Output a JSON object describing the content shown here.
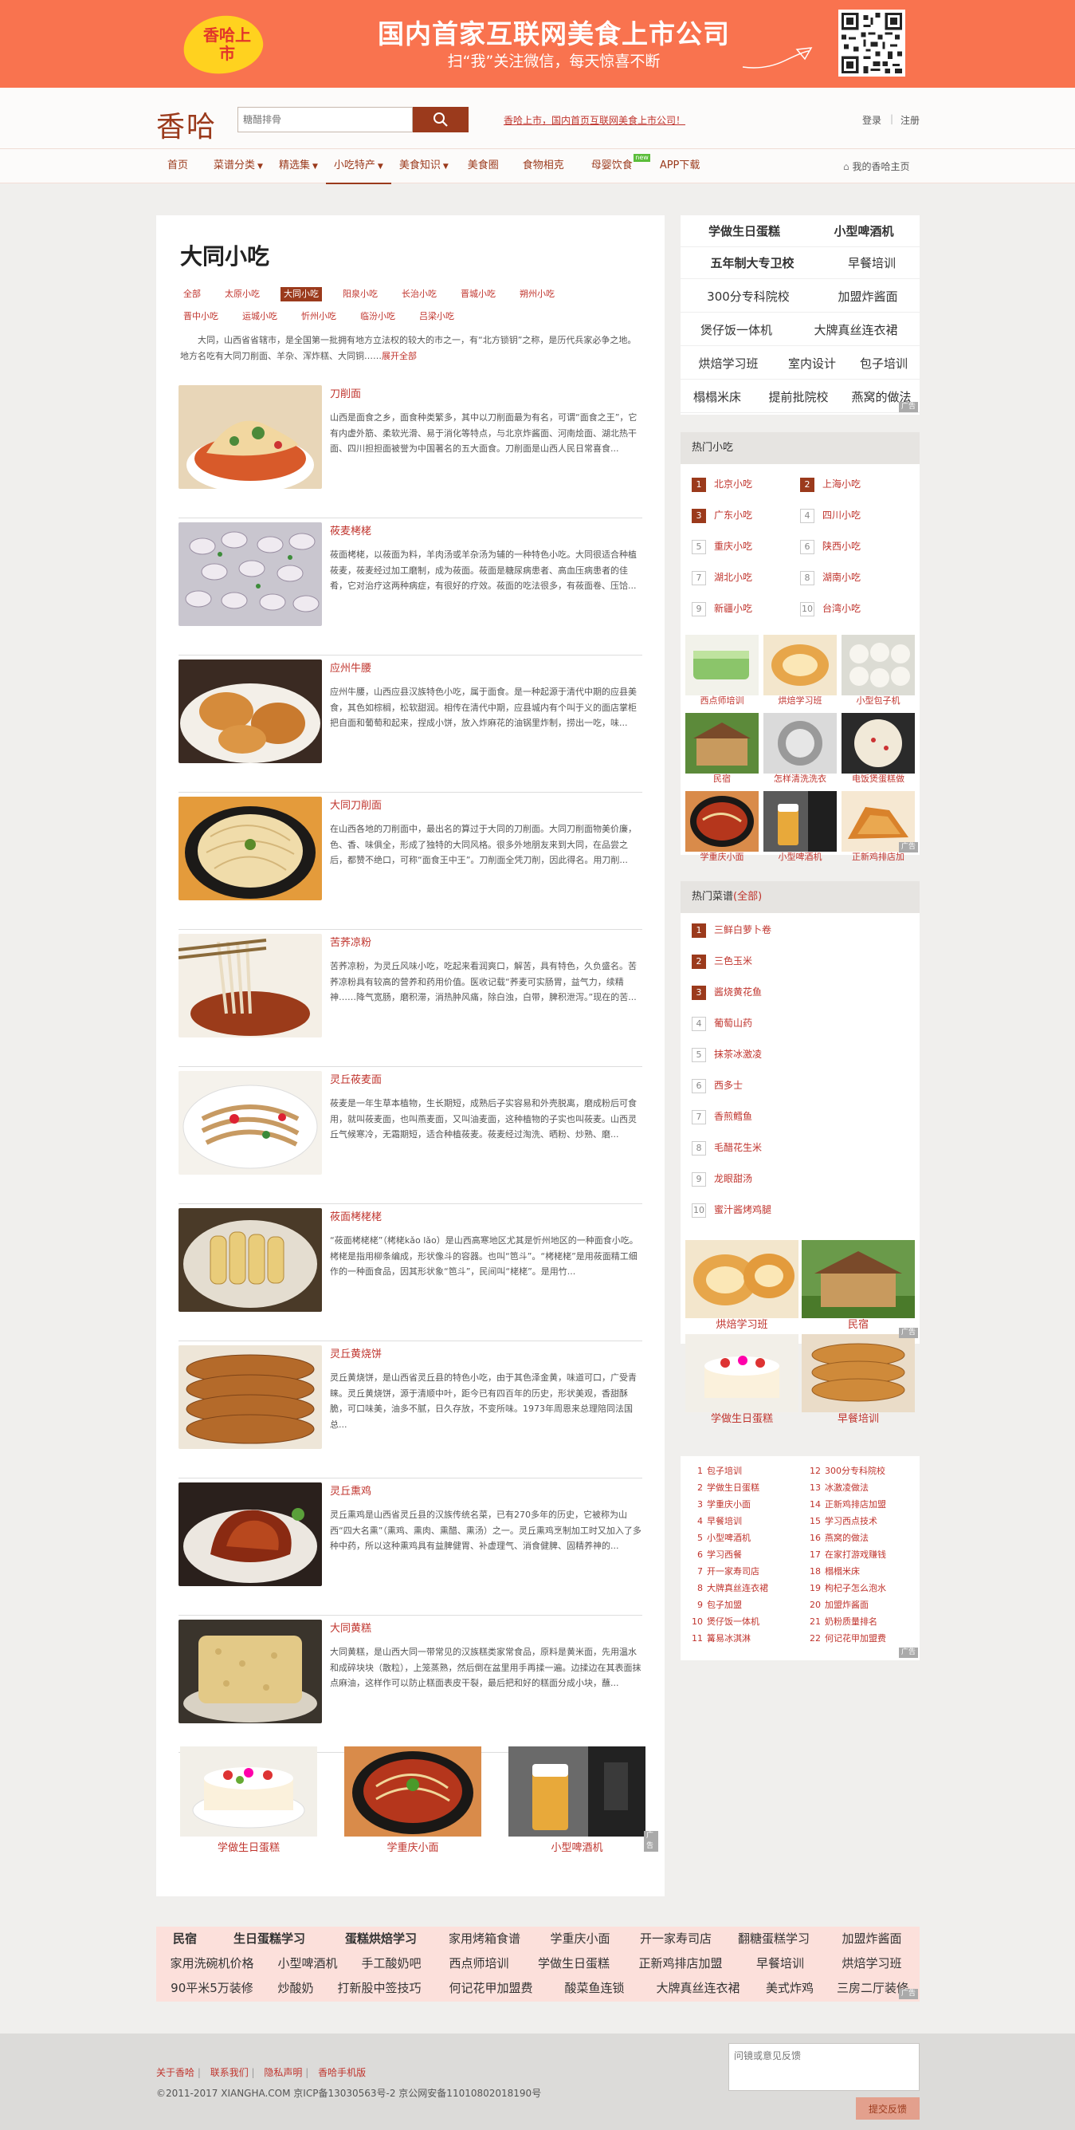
{
  "banner": {
    "badge": "香哈上市",
    "headline": "国内首家互联网美食上市公司",
    "subline": "扫“我”关注微信，每天惊喜不断"
  },
  "header": {
    "logo": "香哈",
    "search_placeholder": "糖醋排骨",
    "promo": "香哈上市，国内首页互联网美食上市公司！",
    "login": "登录",
    "register": "注册"
  },
  "nav": {
    "items": [
      {
        "label": "首页"
      },
      {
        "label": "菜谱分类"
      },
      {
        "label": "精选集"
      },
      {
        "label": "小吃特产"
      },
      {
        "label": "美食知识"
      },
      {
        "label": "美食圈"
      },
      {
        "label": "食物相克"
      },
      {
        "label": "母婴饮食"
      },
      {
        "label": "APP下载"
      }
    ],
    "new_badge": "new",
    "home": "我的香哈主页"
  },
  "main": {
    "title": "大同小吃",
    "categories": [
      "全部",
      "太原小吃",
      "大同小吃",
      "阳泉小吃",
      "长治小吃",
      "晋城小吃",
      "朔州小吃",
      "晋中小吃",
      "运城小吃",
      "忻州小吃",
      "临汾小吃",
      "吕梁小吃"
    ],
    "intro": "大同，山西省省辖市，是全国第一批拥有地方立法权的较大的市之一，有“北方锁钥”之称，是历代兵家必争之地。 地方名吃有大同刀削面、羊杂、浑炸糕、大同铜……",
    "intro_more": "展开全部",
    "items": [
      {
        "name": "刀削面",
        "desc": "山西是面食之乡，面食种类繁多，其中以刀削面最为有名，可谓“面食之王”，它有内虚外筋、柔软光滑、易于消化等特点，与北京炸酱面、河南烩面、湖北热干面、四川担担面被誉为中国著名的五大面食。刀削面是山西人民日常喜食..."
      },
      {
        "name": "莜麦栲栳",
        "desc": "莜面栲栳，以莜面为料，羊肉汤或羊杂汤为辅的一种特色小吃。大同很适合种植莜麦，莜麦经过加工磨制，成为莜面。莜面是糖尿病患者、高血压病患者的佳肴，它对治疗这两种病症，有很好的疗效。莜面的吃法很多，有莜面卷、压饸..."
      },
      {
        "name": "应州牛腰",
        "desc": "应州牛腰，山西应县汉族特色小吃，属于面食。是一种起源于清代中期的应县美食，其色如棕榈，松软甜润。相传在清代中期，应县城内有个叫于义的面店掌柜把自面和葡萄和起来，捏成小饼，放入炸麻花的油锅里炸制，捞出一吃，味..."
      },
      {
        "name": "大同刀削面",
        "desc": "在山西各地的刀削面中，最出名的算过于大同的刀削面。大同刀削面物美价廉，色、香、味俱全，形成了独特的大同风格。很多外地朋友来到大同，在品尝之后，都赞不绝口，可称“面食王中王”。刀削面全凭刀削，因此得名。用刀削..."
      },
      {
        "name": "苦荞凉粉",
        "desc": "苦荞凉粉，为灵丘风味小吃，吃起来看润爽口，解苦，具有特色，久负盛名。苦荞凉粉具有较高的营养和药用价值。医收记载“荞麦可实肠胃，益气力，续精神……降气宽肠，磨积滞，消热肿风痛，除白浊，白带，脾积泄泻。”现在的苦..."
      },
      {
        "name": "灵丘莜麦面",
        "desc": "莜麦是一年生草本植物，生长期短，成熟后子实容易和外壳脱离，磨成粉后可食用，就叫莜麦面，也叫燕麦面，又叫油麦面，这种植物的子实也叫莜麦。山西灵丘气候寒冷，无霜期短，适合种植莜麦。莜麦经过淘洗、晒粉、炒熟、磨..."
      },
      {
        "name": "莜面栲栳栳",
        "desc": "“莜面栲栳栳”（栲栳kǎo lǎo）是山西高寒地区尤其是忻州地区的一种面食小吃。栲栳是指用柳条编成，形状像斗的容器。也叫“笆斗”。“栲栳栳”是用莜面精工细作的一种面食品，因其形状象“笆斗”，民间叫“栳栳”。是用竹..."
      },
      {
        "name": "灵丘黄烧饼",
        "desc": "灵丘黄烧饼，是山西省灵丘县的特色小吃，由于其色泽金黄，味道可口，广受青睐。灵丘黄烧饼，源于清顺中叶，距今已有四百年的历史，形状美观，香甜酥脆，可口味美，油多不腻，日久存放，不变所味。1973年周恩来总理陪同法国总..."
      },
      {
        "name": "灵丘熏鸡",
        "desc": "灵丘熏鸡是山西省灵丘县的汉族传统名菜，已有270多年的历史，它被称为山西“四大名熏”（熏鸡、熏肉、熏醋、熏汤）之一。灵丘熏鸡烹制加工时又加入了多种中药，所以这种熏鸡具有益脾健胃、补虚理气、消食健脾、固精养神的..."
      },
      {
        "name": "大同黄糕",
        "desc": "大同黄糕，是山西大同一带常见的汉族糕类家常食品，原料是黄米面，先用温水和成碎块块（散粒），上笼蒸熟，然后倒在盆里用手再揉一遍。边揉边在其表面抹点麻油，这样作可以防止糕面表皮干裂，最后把和好的糕面分成小块，蘸..."
      }
    ],
    "bottom_ads": [
      "学做生日蛋糕",
      "学重庆小面",
      "小型啤酒机"
    ],
    "ad_tag": "广告"
  },
  "sidebar": {
    "tags": [
      {
        "label": "学做生日蛋糕",
        "bold": true
      },
      {
        "label": "小型啤酒机",
        "bold": true
      },
      {
        "label": "五年制大专卫校",
        "bold": true
      },
      {
        "label": "早餐培训",
        "bold": false
      },
      {
        "label": "300分专科院校",
        "bold": false
      },
      {
        "label": "加盟炸酱面",
        "bold": false
      },
      {
        "label": "煲仔饭一体机",
        "bold": false
      },
      {
        "label": "大牌真丝连衣裙",
        "bold": false
      },
      {
        "label": "烘焙学习班",
        "bold": false
      },
      {
        "label": "室内设计",
        "bold": false
      },
      {
        "label": "包子培训",
        "bold": false
      },
      {
        "label": "榻榻米床",
        "bold": false
      },
      {
        "label": "提前批院校",
        "bold": false
      },
      {
        "label": "燕窝的做法",
        "bold": false
      }
    ],
    "hot_snacks_title": "热门小吃",
    "hot_snacks": [
      "北京小吃",
      "上海小吃",
      "广东小吃",
      "四川小吃",
      "重庆小吃",
      "陕西小吃",
      "湖北小吃",
      "湖南小吃",
      "新疆小吃",
      "台湾小吃"
    ],
    "thumbs1": [
      "西点师培训",
      "烘焙学习班",
      "小型包子机",
      "民宿",
      "怎样清洗洗衣",
      "电饭煲蛋糕做",
      "学重庆小面",
      "小型啤酒机",
      "正新鸡排店加"
    ],
    "hot_recipes_title": "热门菜谱",
    "hot_recipes_all": "(全部)",
    "hot_recipes": [
      "三鲜白萝卜卷",
      "三色玉米",
      "酱烧黄花鱼",
      "葡萄山药",
      "抹茶冰激凌",
      "西多士",
      "香煎鳕鱼",
      "毛醋花生米",
      "龙眼甜汤",
      "蜜汁酱烤鸡腿"
    ],
    "thumbs2": [
      "烘焙学习班",
      "民宿",
      "学做生日蛋糕",
      "早餐培训"
    ],
    "links": [
      "包子培训",
      "300分专科院校",
      "学做生日蛋糕",
      "冰激凌做法",
      "学重庆小面",
      "正新鸡排店加盟",
      "早餐培训",
      "学习西点技术",
      "小型啤酒机",
      "燕窝的做法",
      "学习西餐",
      "在家打游戏赚钱",
      "开一家寿司店",
      "榻榻米床",
      "大牌真丝连衣裙",
      "枸杞子怎么泡水",
      "包子加盟",
      "加盟炸酱面",
      "煲仔饭一体机",
      "奶粉质量排名",
      "篝易冰淇淋",
      "何记花甲加盟费"
    ],
    "ad_tag": "广告"
  },
  "tagblock": {
    "rows": [
      [
        "民宿",
        "生日蛋糕学习",
        "蛋糕烘焙学习",
        "家用烤箱食谱",
        "学重庆小面",
        "开一家寿司店",
        "翻糖蛋糕学习",
        "加盟炸酱面"
      ],
      [
        "家用洗碗机价格",
        "小型啤酒机",
        "手工酸奶吧",
        "西点师培训",
        "学做生日蛋糕",
        "正新鸡排店加盟",
        "早餐培训",
        "烘焙学习班"
      ],
      [
        "90平米5万装修",
        "炒酸奶",
        "打新股中签技巧",
        "何记花甲加盟费",
        "酸菜鱼连锁",
        "大牌真丝连衣裙",
        "美式炸鸡",
        "三房二厅装修"
      ]
    ],
    "bold": [
      "民宿",
      "生日蛋糕学习",
      "蛋糕烘焙学习"
    ],
    "ad_tag": "广告"
  },
  "footer": {
    "links": [
      "关于香哈",
      "联系我们",
      "隐私声明",
      "香哈手机版"
    ],
    "copyright": "©2011-2017 XIANGHA.COM   京ICP备13030563号-2   京公网安备11010802018190号",
    "feedback_placeholder": "问镜或意见反馈",
    "feedback_button": "提交反馈"
  },
  "colors": {
    "accent": "#9b3a1c",
    "banner": "#f9734f",
    "link": "#c0342d"
  }
}
